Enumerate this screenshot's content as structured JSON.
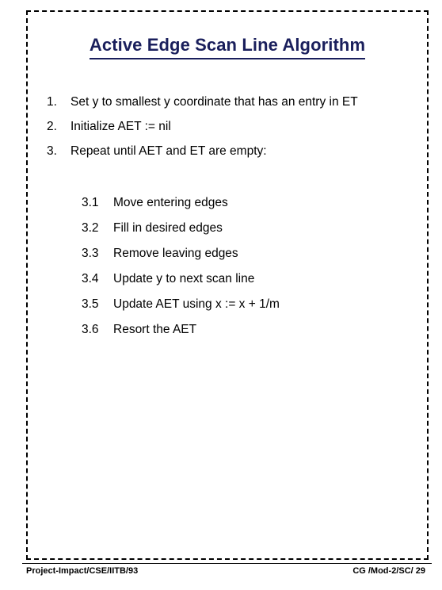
{
  "slide": {
    "title": "Active Edge Scan Line Algorithm",
    "accent_color": "#1a1f5c",
    "text_color": "#000000",
    "background_color": "#ffffff",
    "border_color": "#000000"
  },
  "main_list": [
    {
      "marker": "1.",
      "text": "Set y to smallest y coordinate that has an entry in ET"
    },
    {
      "marker": "2.",
      "text": "Initialize AET := nil"
    },
    {
      "marker": "3.",
      "text": "Repeat until AET and ET are empty:"
    }
  ],
  "sub_list": [
    {
      "marker": "3.1",
      "text": "Move entering edges"
    },
    {
      "marker": "3.2",
      "text": "Fill in desired edges"
    },
    {
      "marker": "3.3",
      "text": "Remove leaving edges"
    },
    {
      "marker": "3.4",
      "text": "Update y to next scan line"
    },
    {
      "marker": "3.5",
      "text": "Update AET using x := x + 1/m"
    },
    {
      "marker": "3.6",
      "text": "Resort the AET"
    }
  ],
  "footer": {
    "left": "Project-Impact/CSE/IITB/93",
    "right": "CG /Mod-2/SC/ 29"
  }
}
